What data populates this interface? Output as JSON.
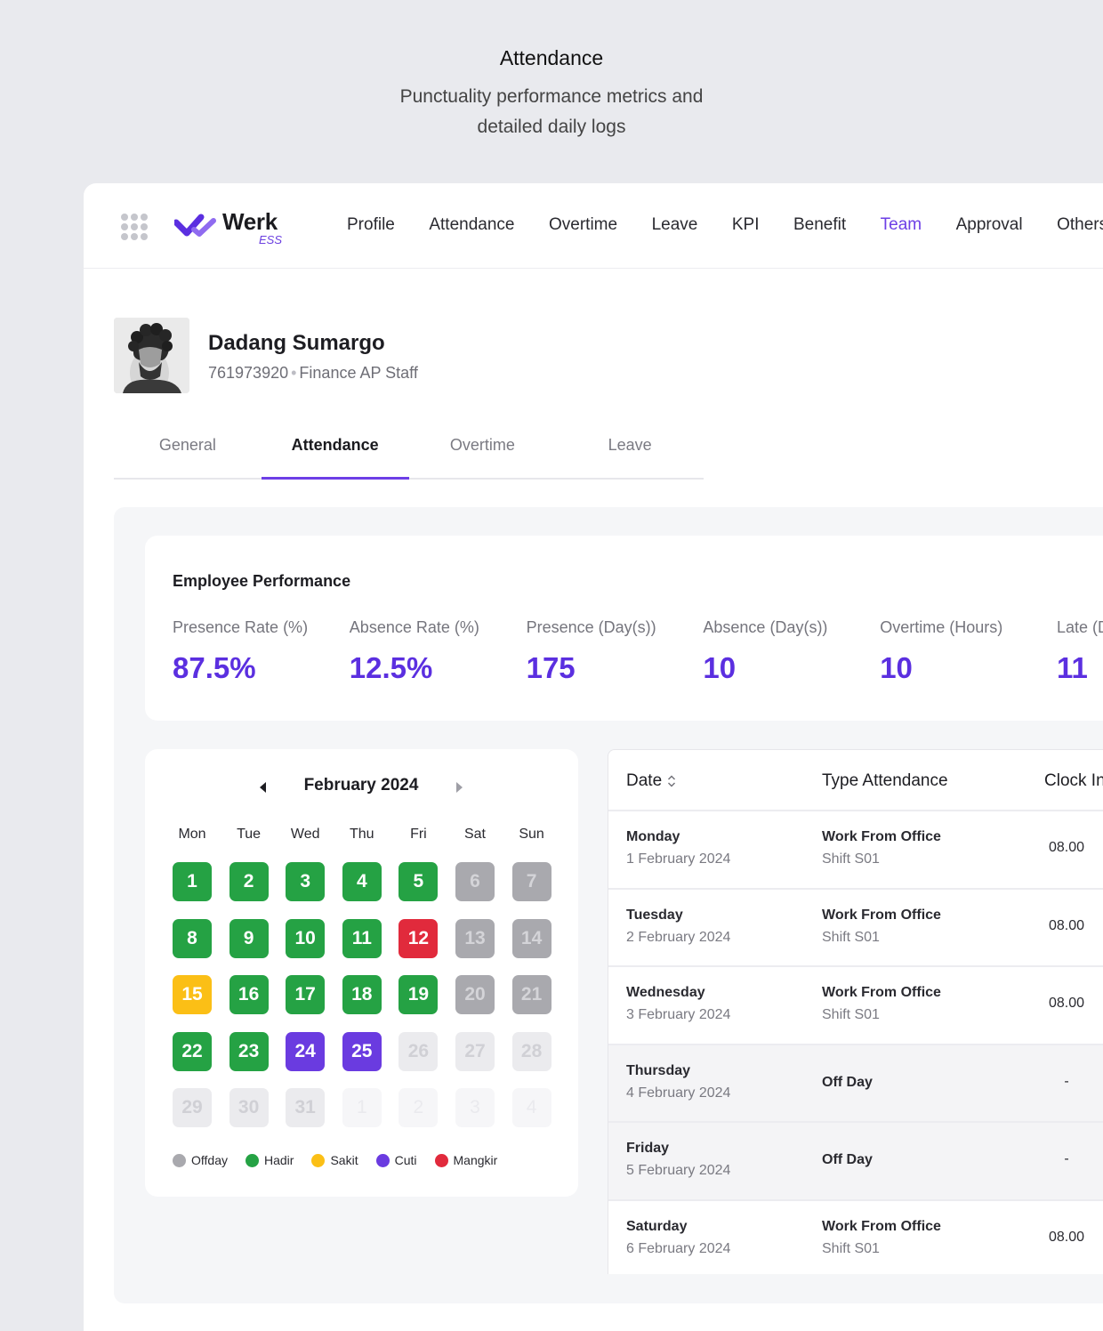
{
  "hero": {
    "title": "Attendance",
    "subtitle": "Punctuality performance metrics and detailed daily logs"
  },
  "brand": {
    "name": "Werk",
    "sub": "ESS",
    "accent": "#6d3fe6"
  },
  "nav": {
    "items": [
      "Profile",
      "Attendance",
      "Overtime",
      "Leave",
      "KPI",
      "Benefit",
      "Team",
      "Approval",
      "Others"
    ],
    "active": "Team"
  },
  "employee": {
    "name": "Dadang Sumargo",
    "id": "761973920",
    "separator": "•",
    "position": "Finance AP Staff"
  },
  "tabs": {
    "items": [
      "General",
      "Attendance",
      "Overtime",
      "Leave"
    ],
    "active": "Attendance"
  },
  "performance": {
    "title": "Employee Performance",
    "metrics": [
      {
        "label": "Presence Rate (%)",
        "value": "87.5%"
      },
      {
        "label": "Absence Rate (%)",
        "value": "12.5%"
      },
      {
        "label": "Presence (Day(s))",
        "value": "175"
      },
      {
        "label": "Absence (Day(s))",
        "value": "10"
      },
      {
        "label": "Overtime (Hours)",
        "value": "10"
      },
      {
        "label": "Late (Day(s))",
        "value": "11"
      }
    ]
  },
  "calendar": {
    "month": "February 2024",
    "weekdays": [
      "Mon",
      "Tue",
      "Wed",
      "Thu",
      "Fri",
      "Sat",
      "Sun"
    ],
    "days": [
      {
        "n": "1",
        "s": "hadir"
      },
      {
        "n": "2",
        "s": "hadir"
      },
      {
        "n": "3",
        "s": "hadir"
      },
      {
        "n": "4",
        "s": "hadir"
      },
      {
        "n": "5",
        "s": "hadir"
      },
      {
        "n": "6",
        "s": "off"
      },
      {
        "n": "7",
        "s": "off"
      },
      {
        "n": "8",
        "s": "hadir"
      },
      {
        "n": "9",
        "s": "hadir"
      },
      {
        "n": "10",
        "s": "hadir"
      },
      {
        "n": "11",
        "s": "hadir"
      },
      {
        "n": "12",
        "s": "mangkir"
      },
      {
        "n": "13",
        "s": "off"
      },
      {
        "n": "14",
        "s": "off"
      },
      {
        "n": "15",
        "s": "sakit"
      },
      {
        "n": "16",
        "s": "hadir"
      },
      {
        "n": "17",
        "s": "hadir"
      },
      {
        "n": "18",
        "s": "hadir"
      },
      {
        "n": "19",
        "s": "hadir"
      },
      {
        "n": "20",
        "s": "off"
      },
      {
        "n": "21",
        "s": "off"
      },
      {
        "n": "22",
        "s": "hadir"
      },
      {
        "n": "23",
        "s": "hadir"
      },
      {
        "n": "24",
        "s": "cuti"
      },
      {
        "n": "25",
        "s": "cuti"
      },
      {
        "n": "26",
        "s": "faded"
      },
      {
        "n": "27",
        "s": "faded"
      },
      {
        "n": "28",
        "s": "faded"
      },
      {
        "n": "29",
        "s": "faded"
      },
      {
        "n": "30",
        "s": "faded"
      },
      {
        "n": "31",
        "s": "faded"
      },
      {
        "n": "1",
        "s": "out"
      },
      {
        "n": "2",
        "s": "out"
      },
      {
        "n": "3",
        "s": "out"
      },
      {
        "n": "4",
        "s": "out"
      }
    ],
    "legend": [
      {
        "label": "Offday",
        "color": "#a9a9ae"
      },
      {
        "label": "Hadir",
        "color": "#25a244"
      },
      {
        "label": "Sakit",
        "color": "#fbbf16"
      },
      {
        "label": "Cuti",
        "color": "#6a3be0"
      },
      {
        "label": "Mangkir",
        "color": "#e12a3c"
      }
    ]
  },
  "table": {
    "headers": [
      "Date",
      "Type Attendance",
      "Clock In"
    ],
    "rows": [
      {
        "day": "Monday",
        "date": "1 February 2024",
        "type": "Work From Office",
        "shift": "Shift S01",
        "clock_in": "08.00"
      },
      {
        "day": "Tuesday",
        "date": "2 February 2024",
        "type": "Work From Office",
        "shift": "Shift S01",
        "clock_in": "08.00"
      },
      {
        "day": "Wednesday",
        "date": "3 February 2024",
        "type": "Work From Office",
        "shift": "Shift S01",
        "clock_in": "08.00"
      },
      {
        "day": "Thursday",
        "date": "4 February 2024",
        "type": "Off Day",
        "shift": "",
        "clock_in": "-"
      },
      {
        "day": "Friday",
        "date": "5 February 2024",
        "type": "Off Day",
        "shift": "",
        "clock_in": "-"
      },
      {
        "day": "Saturday",
        "date": "6 February 2024",
        "type": "Work From Office",
        "shift": "Shift S01",
        "clock_in": "08.00"
      }
    ]
  }
}
